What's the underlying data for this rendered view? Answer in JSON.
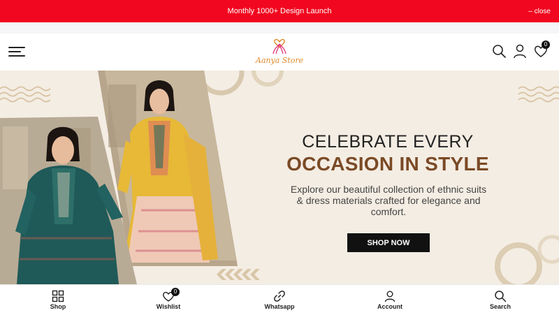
{
  "announcement": {
    "text": "Monthly 1000+ Design Launch",
    "close_label": "close"
  },
  "header": {
    "logo_text": "Aanya Store",
    "wishlist_count": "0"
  },
  "hero": {
    "title_line1": "CELEBRATE EVERY",
    "title_line2": "OCCASION IN STYLE",
    "description": "Explore our beautiful collection of ethnic suits & dress materials crafted for elegance and comfort.",
    "cta_label": "SHOP NOW"
  },
  "bottom_nav": {
    "items": [
      {
        "label": "Shop",
        "icon": "grid-icon"
      },
      {
        "label": "Wishlist",
        "icon": "heart-icon",
        "badge": "0"
      },
      {
        "label": "Whatsapp",
        "icon": "link-icon"
      },
      {
        "label": "Account",
        "icon": "user-icon"
      },
      {
        "label": "Search",
        "icon": "search-icon"
      }
    ]
  },
  "colors": {
    "announcement_bg": "#f1071f",
    "accent_brown": "#7a4a26",
    "logo_orange": "#e08a2c",
    "logo_pink": "#e0397a"
  }
}
